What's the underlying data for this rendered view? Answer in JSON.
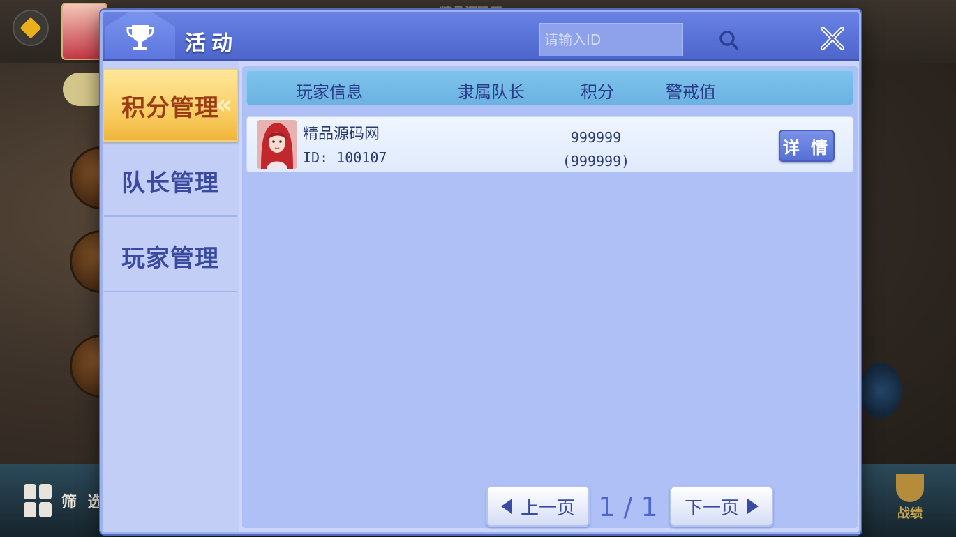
{
  "background": {
    "title_peek": "精品源码网",
    "filter_label": "筛 选",
    "record_label": "战绩"
  },
  "dialog": {
    "title": "活动",
    "search": {
      "placeholder": "请输入ID",
      "value": ""
    }
  },
  "sidebar": {
    "items": [
      {
        "label": "积分管理",
        "active": true
      },
      {
        "label": "队长管理",
        "active": false
      },
      {
        "label": "玩家管理",
        "active": false
      }
    ]
  },
  "table": {
    "columns": [
      "玩家信息",
      "隶属队长",
      "积分",
      "警戒值"
    ],
    "rows": [
      {
        "name": "精品源码网",
        "id": "ID: 100107",
        "captain": "",
        "score": "999999",
        "score_sub": "(999999)",
        "warning": "",
        "detail_label": "详 情"
      }
    ]
  },
  "pagination": {
    "prev_label": "上一页",
    "next_label": "下一页",
    "page_indicator": "1 / 1"
  },
  "colors": {
    "header_blue": "#5872d8",
    "active_tab_gold": "#f7c95a",
    "active_tab_text": "#9b3c14",
    "panel_blue": "#aec0f6"
  }
}
